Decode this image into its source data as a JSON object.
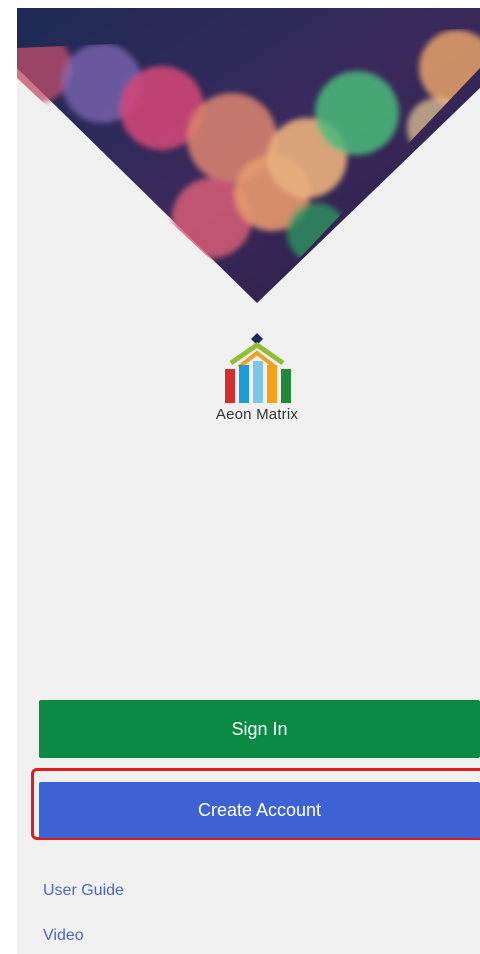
{
  "brand": {
    "name": "Aeon Matrix",
    "logo_icon": "aeon-matrix-house-logo"
  },
  "buttons": {
    "sign_in": "Sign In",
    "create_account": "Create Account"
  },
  "links": {
    "user_guide": "User Guide",
    "video": "Video"
  },
  "colors": {
    "background": "#f0f0f0",
    "sign_in": "#0b8a44",
    "create_account": "#3c62d3",
    "link": "#4a67c7",
    "highlight": "#e21b1b"
  }
}
